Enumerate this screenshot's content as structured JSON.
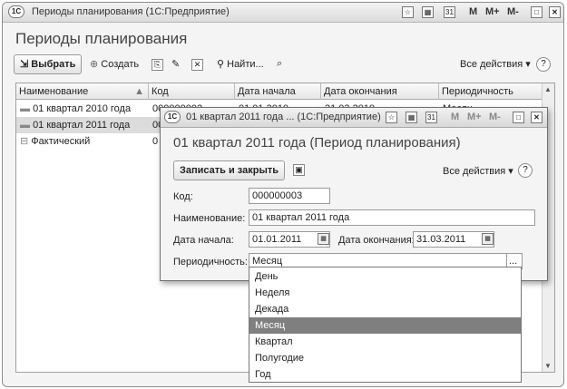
{
  "main_window": {
    "title": "Периоды планирования  (1С:Предприятие)",
    "heading": "Периоды планирования",
    "title_controls": [
      "M",
      "M+",
      "M-"
    ],
    "toolbar": {
      "select": "Выбрать",
      "create": "Создать",
      "find": "Найти...",
      "all_actions": "Все действия ▾",
      "help": "?"
    },
    "columns": [
      "Наименование",
      "Код",
      "Дата начала",
      "Дата окончания",
      "Периодичность"
    ],
    "rows": [
      {
        "name": "01 квартал 2010 года",
        "code": "000000002",
        "start": "01.01.2010",
        "end": "31.03.2010",
        "period": "Месяц"
      },
      {
        "name": "01 квартал 2011 года",
        "code": "000000003",
        "start": "",
        "end": "",
        "period": ""
      },
      {
        "name": "Фактический",
        "code": "0",
        "start": "",
        "end": "",
        "period": ""
      }
    ]
  },
  "dialog": {
    "title": "01 квартал 2011 года ...  (1С:Предприятие)",
    "heading": "01 квартал 2011 года (Период планирования)",
    "title_controls": [
      "M",
      "M+",
      "M-"
    ],
    "save_close": "Записать и закрыть",
    "all_actions": "Все действия ▾",
    "help": "?",
    "fields": {
      "code_label": "Код:",
      "code": "000000003",
      "name_label": "Наименование:",
      "name": "01 квартал 2011 года",
      "start_label": "Дата начала:",
      "start": "01.01.2011",
      "end_label": "Дата окончания:",
      "end": "31.03.2011",
      "period_label": "Периодичность:",
      "period": "Месяц",
      "period_btn": "..."
    }
  },
  "dropdown": {
    "options": [
      "День",
      "Неделя",
      "Декада",
      "Месяц",
      "Квартал",
      "Полугодие",
      "Год"
    ],
    "selected": "Месяц"
  }
}
